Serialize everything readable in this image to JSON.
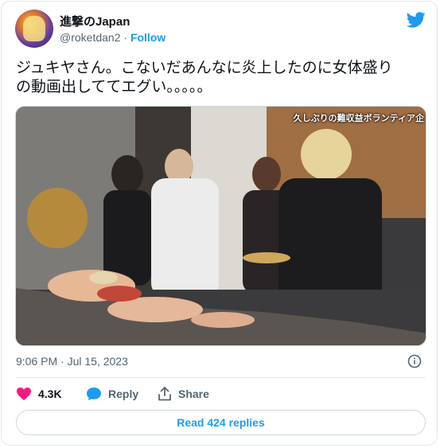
{
  "author": {
    "display_name": "進撃のJapan",
    "handle": "@roketdan2",
    "separator": "·",
    "follow_label": "Follow"
  },
  "tweet": {
    "text_line1": "ジュキヤさん。こないだあんなに炎上したのに女体盛り",
    "text_line2": "の動画出しててエグい。。。。。",
    "media_overlay_text": "久しぶりの難収益ボランティア企",
    "timestamp": "9:06 PM · Jul 15, 2023"
  },
  "actions": {
    "like_count": "4.3K",
    "reply_label": "Reply",
    "share_label": "Share"
  },
  "read_replies_label": "Read 424 replies",
  "colors": {
    "accent": "#1d9bf0",
    "like": "#f91880",
    "secondary_text": "#536471",
    "border": "#cfd9de"
  },
  "icons": [
    "twitter-bird-icon",
    "info-icon",
    "heart-icon",
    "reply-bubble-icon",
    "share-icon"
  ]
}
